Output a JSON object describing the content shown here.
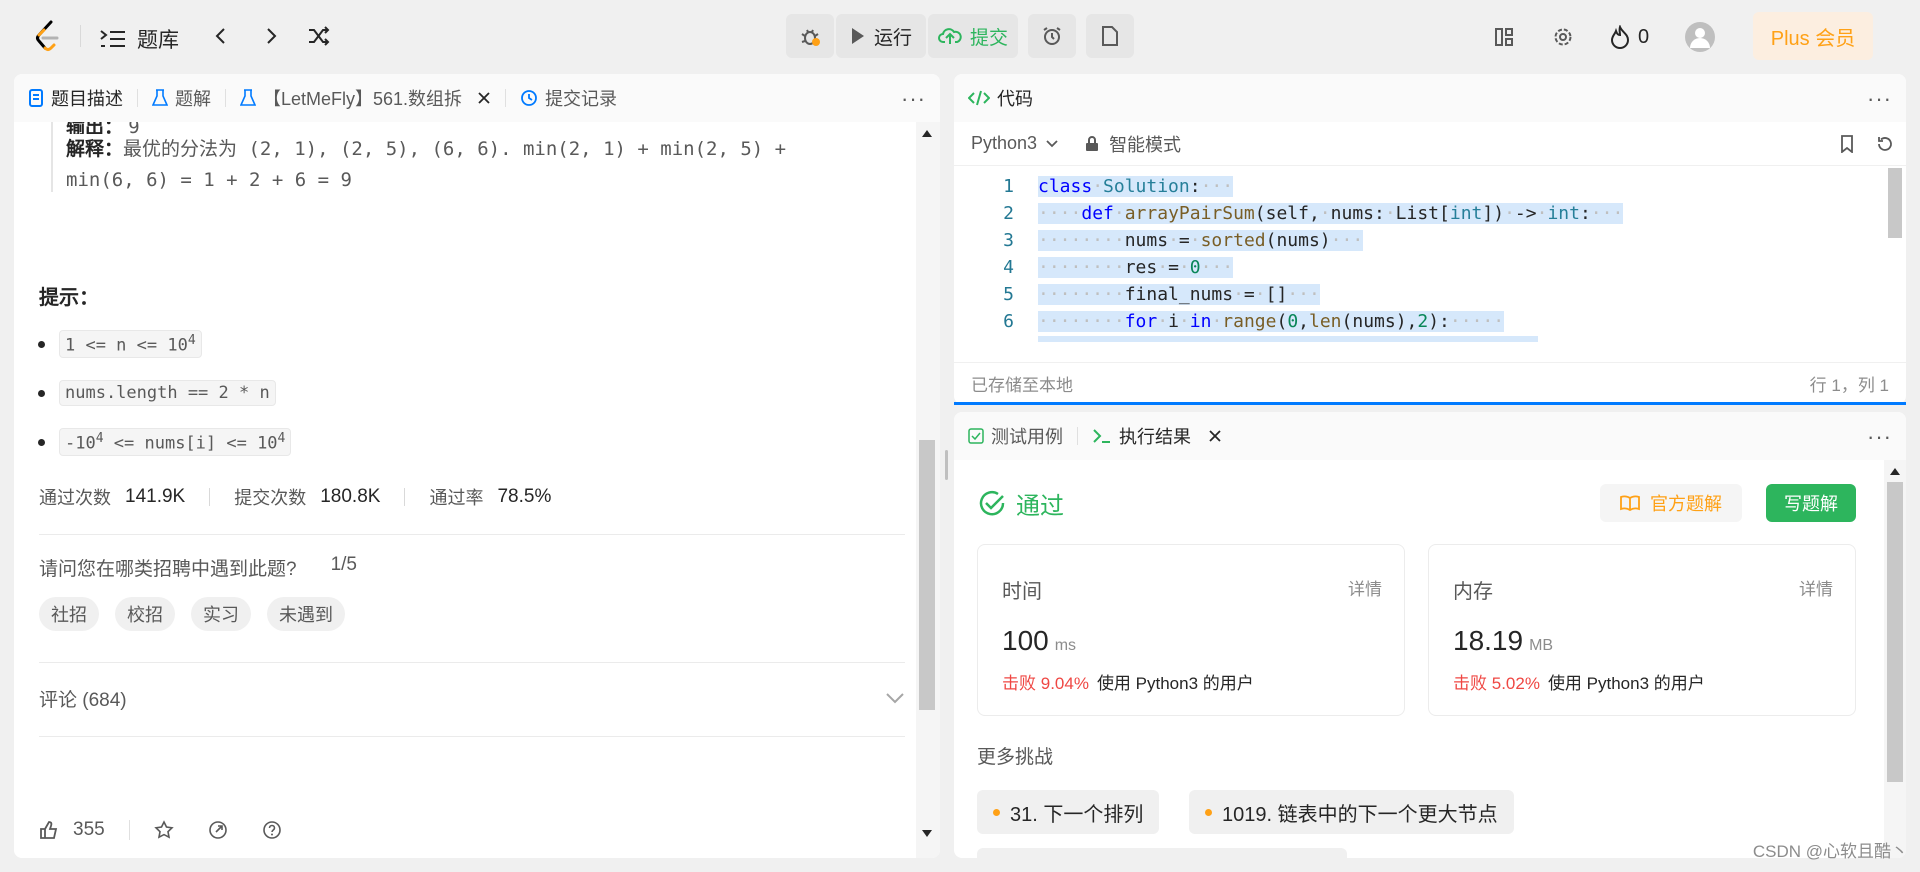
{
  "nav": {
    "title": "题库",
    "counter": "0",
    "plus": "Plus 会员"
  },
  "toolbar": {
    "run": "运行",
    "submit": "提交"
  },
  "left": {
    "tabs": [
      "题目描述",
      "题解",
      "【LetMeFly】561.数组拆",
      "提交记录"
    ],
    "example": {
      "output_label": "输出：",
      "output_value": "9",
      "explain_label": "解释：",
      "explain_1": "最优的分法为 (2, 1), (2, 5), (6, 6). min(2, 1) + min(2, 5) +",
      "explain_2": "min(6, 6) = 1 + 2 + 6 = 9"
    },
    "hint_title": "提示：",
    "hints": [
      {
        "base": "1 <= n <= 10",
        "sup": "4",
        "tail": ""
      },
      {
        "base": "nums.length == 2 * n",
        "sup": "",
        "tail": ""
      },
      {
        "base": "-10",
        "sup": "4",
        "tail": " <= nums[i] <= 10",
        "sup2": "4"
      }
    ],
    "stats": {
      "accepted_label": "通过次数",
      "accepted": "141.9K",
      "submitted_label": "提交次数",
      "submitted": "180.8K",
      "rate_label": "通过率",
      "rate": "78.5%"
    },
    "survey": {
      "question": "请问您在哪类招聘中遇到此题?",
      "page": "1/5",
      "tags": [
        "社招",
        "校招",
        "实习",
        "未遇到"
      ]
    },
    "comments": "评论 (684)",
    "likes": "355"
  },
  "editor": {
    "title": "代码",
    "language": "Python3",
    "mode": "智能模式",
    "status_left": "已存储至本地",
    "status_right": "行 1，列 1",
    "line_numbers": [
      "1",
      "2",
      "3",
      "4",
      "5",
      "6"
    ]
  },
  "result": {
    "tabs": [
      "测试用例",
      "执行结果"
    ],
    "status": "通过",
    "official": "官方题解",
    "write": "写题解",
    "time": {
      "label": "时间",
      "detail": "详情",
      "value": "100",
      "unit": "ms",
      "beat_label": "击败",
      "beat": "9.04%",
      "suffix": "使用 Python3 的用户"
    },
    "memory": {
      "label": "内存",
      "detail": "详情",
      "value": "18.19",
      "unit": "MB",
      "beat_label": "击败",
      "beat": "5.02%",
      "suffix": "使用 Python3 的用户"
    },
    "more": "更多挑战",
    "challenges": [
      "31. 下一个排列",
      "1019. 链表中的下一个更大节点"
    ]
  },
  "watermark": "CSDN @心软且酷丶",
  "colors": {
    "accent": "#ffa116",
    "green": "#2db55d",
    "red": "#ef4743",
    "blue": "#007aff"
  }
}
